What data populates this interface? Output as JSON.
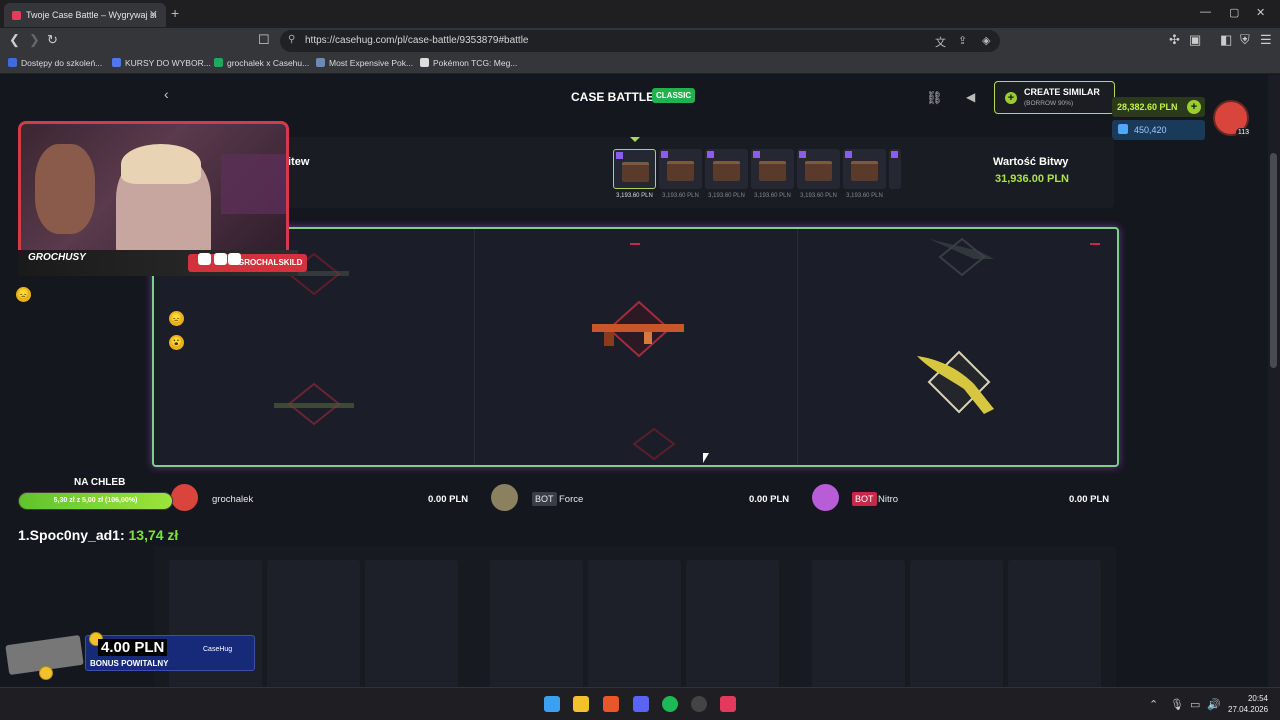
{
  "browser": {
    "tab_title": "Twoje Case Battle – Wygrywaj si",
    "tab_close": "✕",
    "new_tab": "+",
    "window_controls": [
      "—",
      "▢",
      "✕"
    ],
    "url": "https://casehug.com/pl/case-battle/9353879#battle",
    "bookmarks": [
      {
        "label": "Dostępy do szkoleń...",
        "color": "#3b6ed8"
      },
      {
        "label": "KURSY DO WYBOR...",
        "color": "#4a7be8"
      },
      {
        "label": "grochalek x Casehu...",
        "color": "#22a85a"
      },
      {
        "label": "Most Expensive Pok...",
        "color": "#6a8ab8"
      },
      {
        "label": "Pokémon TCG: Meg...",
        "color": "#dddddd"
      }
    ]
  },
  "header": {
    "title": "CASE BATTLE",
    "mode_badge": "CLASSIC",
    "create_similar": "CREATE SIMILAR",
    "create_similar_sub": "(BORROW 90%)",
    "balance": "28,382.60 PLN",
    "diamonds": "450,420",
    "user_level": "113"
  },
  "battle_info": {
    "cases_label_partial": "itew",
    "case_price": "3,193.60 PLN",
    "case_count_visible": 7,
    "worth_label": "Wartość Bitwy",
    "worth_value": "31,936.00 PLN"
  },
  "players": [
    {
      "name": "grochalek",
      "bot": false,
      "value": "0.00 PLN",
      "avatar_color": "#d9453d"
    },
    {
      "name": "Force",
      "bot": true,
      "bot_label": "BOT",
      "value": "0.00 PLN",
      "avatar_color": "#8b8160"
    },
    {
      "name": "Nitro",
      "bot": true,
      "bot_label": "BOT",
      "value": "0.00 PLN",
      "avatar_color": "#b95cd8"
    }
  ],
  "overlay": {
    "channel_handle": "GROCHALSKILD",
    "channel_logo": "GROCHUSY",
    "goal_title": "NA CHLEB",
    "goal_text": "5,30 zł z 5,00 zł (106,00%)",
    "goal_fraction": 1.0,
    "top_donor_name": "1.Spoc0ny_ad1:",
    "top_donor_amount": "13,74 zł",
    "bonus_amount": "4.00 PLN",
    "bonus_label": "BONUS POWITALNY",
    "bonus_brand": "CaseHug"
  },
  "emojis": [
    "😞",
    "😞",
    "😮"
  ],
  "taskbar": {
    "time": "20:54",
    "date": "27.04.2026"
  },
  "colors": {
    "accent_green": "#a9e34b",
    "battle_border": "#7ecf8a",
    "bot_red": "#c6284a"
  }
}
